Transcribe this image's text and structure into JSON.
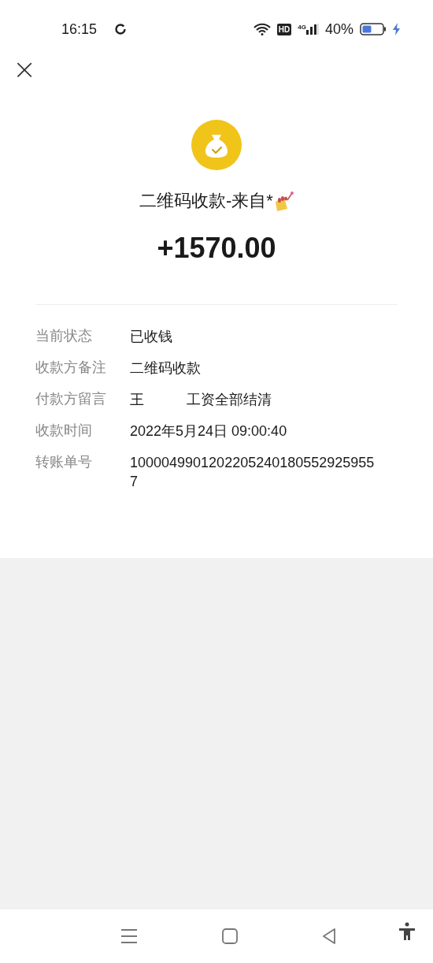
{
  "status_bar": {
    "time": "16:15",
    "hd_badge": "HD",
    "network": "4G",
    "battery": "40%"
  },
  "header": {
    "close_label": "×"
  },
  "receipt": {
    "title": "二维码收款-来自*",
    "amount": "+1570.00"
  },
  "details": [
    {
      "label": "当前状态",
      "value": "已收钱"
    },
    {
      "label": "收款方备注",
      "value": "二维码收款"
    },
    {
      "label": "付款方留言",
      "value": "王　　　工资全部结清"
    },
    {
      "label": "收款时间",
      "value": "2022年5月24日 09:00:40"
    },
    {
      "label": "转账单号",
      "value": "10000499012022052401805529259557"
    }
  ]
}
